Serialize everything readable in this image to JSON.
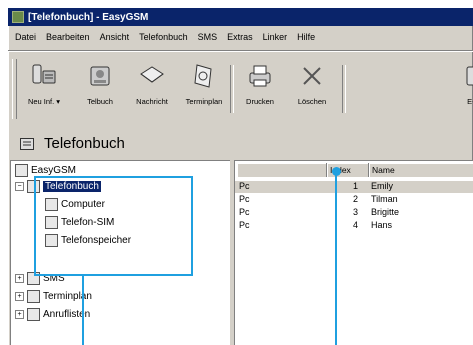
{
  "window": {
    "title": "[Telefonbuch] - EasyGSM"
  },
  "menu": [
    "Datei",
    "Bearbeiten",
    "Ansicht",
    "Telefonbuch",
    "SMS",
    "Extras",
    "Linker",
    "Hilfe"
  ],
  "toolbar": {
    "buttons": [
      {
        "label": "Neu Inf.",
        "icon": "new-entry-icon"
      },
      {
        "label": "Telbuch",
        "icon": "phonebook-icon"
      },
      {
        "label": "Nachricht",
        "icon": "message-icon"
      },
      {
        "label": "Terminplan",
        "icon": "calendar-icon"
      },
      {
        "label": "Drucken",
        "icon": "print-icon"
      },
      {
        "label": "Löschen",
        "icon": "delete-icon"
      },
      {
        "label": "E-M",
        "icon": "email-icon"
      }
    ]
  },
  "header": {
    "title": "Telefonbuch"
  },
  "tree": {
    "root": "EasyGSM",
    "phonebook": "Telefonbuch",
    "children": [
      "Computer",
      "Telefon-SIM",
      "Telefonspeicher"
    ],
    "other": [
      "SMS",
      "Terminplan",
      "Anruflisten"
    ]
  },
  "list": {
    "columns": [
      "",
      "Index",
      "Name"
    ],
    "rows": [
      {
        "loc": "Pc",
        "index": "1",
        "name": "Emily"
      },
      {
        "loc": "Pc",
        "index": "2",
        "name": "Tilman"
      },
      {
        "loc": "Pc",
        "index": "3",
        "name": "Brigitte"
      },
      {
        "loc": "Pc",
        "index": "4",
        "name": "Hans"
      }
    ]
  },
  "colors": {
    "callout": "#1fa0e0",
    "selection": "#0a246a",
    "titlebar": "#0a246a"
  }
}
